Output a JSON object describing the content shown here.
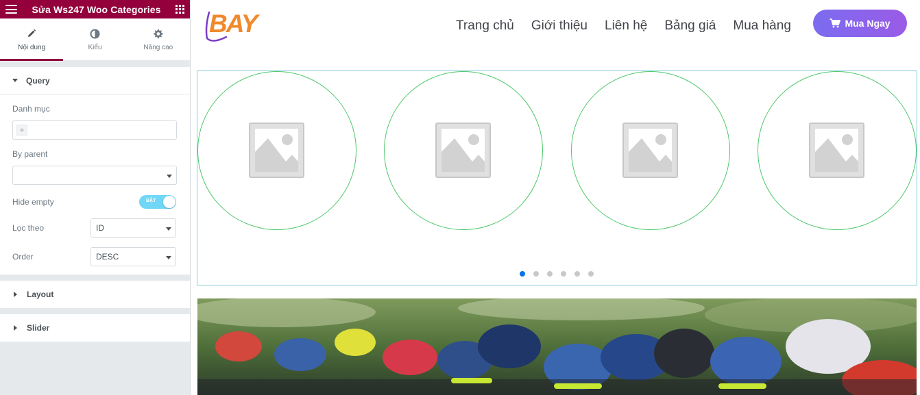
{
  "panel": {
    "title": "Sửa Ws247 Woo Categories",
    "header_color": "#93003c",
    "tabs": [
      {
        "label": "Nội dung",
        "icon": "pencil-icon",
        "active": true
      },
      {
        "label": "Kiểu",
        "icon": "contrast-icon",
        "active": false
      },
      {
        "label": "Nâng cao",
        "icon": "gear-icon",
        "active": false
      }
    ],
    "query": {
      "title": "Query",
      "category_label": "Danh mục",
      "category_add_symbol": "+",
      "by_parent_label": "By parent",
      "by_parent_value": "",
      "hide_empty_label": "Hide empty",
      "hide_empty_toggle_text": "BẬT",
      "hide_empty_on": true,
      "filter_label": "Lọc theo",
      "filter_value": "ID",
      "order_label": "Order",
      "order_value": "DESC"
    },
    "sections": [
      {
        "title": "Layout"
      },
      {
        "title": "Slider"
      }
    ]
  },
  "site": {
    "logo_text": "BAY",
    "nav": [
      "Trang chủ",
      "Giới thiệu",
      "Liên hệ",
      "Bảng giá",
      "Mua hàng"
    ],
    "buy_button": "Mua Ngay",
    "slider": {
      "slides": [
        "image-placeholder-icon",
        "image-placeholder-icon",
        "image-placeholder-icon",
        "image-placeholder-icon"
      ],
      "dot_count": 6,
      "active_dot": 1,
      "active_dot_color": "#0b73e6"
    },
    "banner": {
      "subject": "cyclists-helmets-photo"
    }
  }
}
